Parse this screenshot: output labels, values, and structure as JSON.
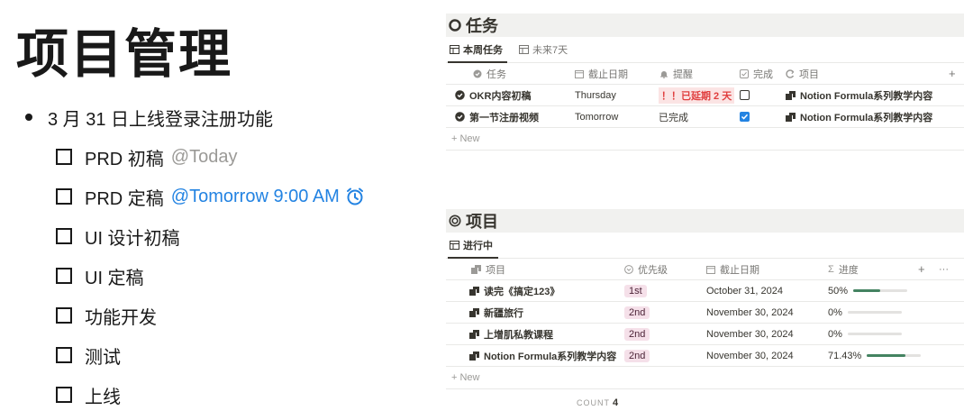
{
  "note": {
    "title": "项目管理",
    "bullet": "3 月 31 日上线登录注册功能",
    "todos": [
      {
        "label": "PRD 初稿",
        "mention": "@Today",
        "mention_style": "gray"
      },
      {
        "label": "PRD 定稿",
        "mention": "@Tomorrow 9:00 AM",
        "mention_style": "blue",
        "icon": "alarm-clock-icon"
      },
      {
        "label": "UI 设计初稿"
      },
      {
        "label": "UI 定稿"
      },
      {
        "label": "功能开发"
      },
      {
        "label": "测试"
      },
      {
        "label": "上线"
      }
    ]
  },
  "tasks_db": {
    "title": "任务",
    "title_icon": "circle-icon",
    "views": [
      "本周任务",
      "未来7天"
    ],
    "columns": [
      "任务",
      "截止日期",
      "提醒",
      "完成",
      "项目"
    ],
    "add_column": "+",
    "rows": [
      {
        "task": "OKR内容初稿",
        "due": "Thursday",
        "reminder": "！！已延期 2 天",
        "reminder_style": "overdue",
        "done": false,
        "project": "Notion Formula系列教学内容"
      },
      {
        "task": "第一节注册视频",
        "due": "Tomorrow",
        "reminder": "已完成",
        "reminder_style": "normal",
        "done": true,
        "project": "Notion Formula系列教学内容"
      }
    ],
    "new_label": "+ New"
  },
  "projects_db": {
    "title": "项目",
    "title_icon": "target-icon",
    "views": [
      "进行中"
    ],
    "columns": [
      "项目",
      "优先级",
      "截止日期",
      "进度"
    ],
    "add_column": "+",
    "more": "···",
    "rows": [
      {
        "project": "读完《搞定123》",
        "priority": "1st",
        "due": "October 31, 2024",
        "progress_label": "50%",
        "progress": 0.5
      },
      {
        "project": "新疆旅行",
        "priority": "2nd",
        "due": "November 30, 2024",
        "progress_label": "0%",
        "progress": 0
      },
      {
        "project": "上增肌私教课程",
        "priority": "2nd",
        "due": "November 30, 2024",
        "progress_label": "0%",
        "progress": 0
      },
      {
        "project": "Notion Formula系列教学内容",
        "priority": "2nd",
        "due": "November 30, 2024",
        "progress_label": "71.43%",
        "progress": 0.7143
      }
    ],
    "new_label": "+ New",
    "count_label": "COUNT",
    "count_value": "4"
  },
  "colors": {
    "accent_blue": "#2383e2",
    "overdue_red": "#e03e3e",
    "progress_green": "#448361",
    "tag_pink": "#f5e0e9"
  }
}
